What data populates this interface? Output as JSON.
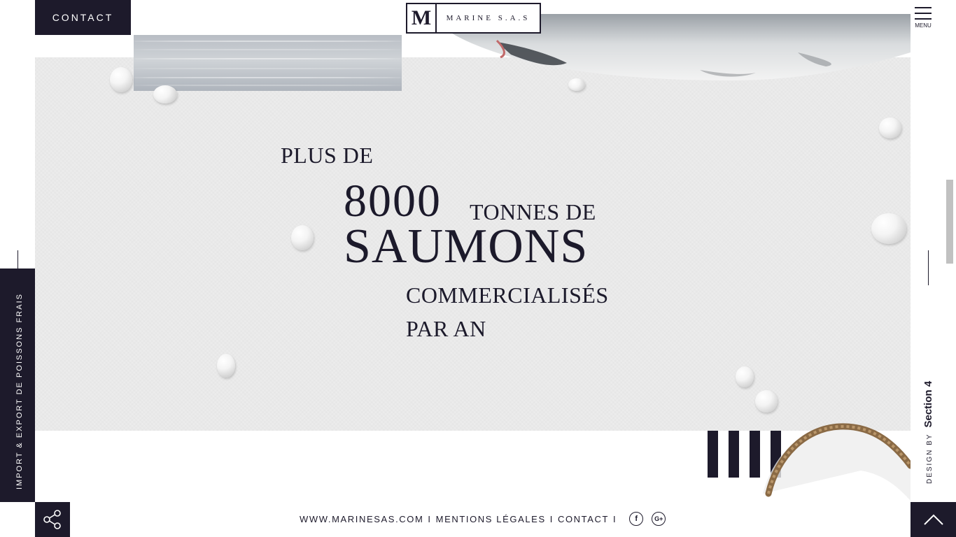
{
  "header": {
    "contact_label": "CONTACT",
    "logo_mark": "M",
    "logo_text": "MARINE S.A.S",
    "menu_label": "MENU"
  },
  "headline": {
    "line1": "PLUS DE",
    "number": "8000",
    "unit": "TONNES DE",
    "product": "SAUMONS",
    "line4": "COMMERCIALISÉS",
    "line5": "PAR AN"
  },
  "sidebar": {
    "tagline": "IMPORT & EXPORT DE POISSONS FRAIS"
  },
  "credit": {
    "design_by": "DESIGN BY",
    "studio": "Section 4"
  },
  "footer": {
    "site": "WWW.MARINESAS.COM",
    "separator": "I",
    "legal": "MENTIONS LÉGALES",
    "contact": "CONTACT",
    "facebook_glyph": "f",
    "google_glyph": "G+"
  },
  "icons": {
    "share": "share-icon",
    "up": "chevron-up-icon",
    "menu": "hamburger-icon",
    "facebook": "facebook-icon",
    "google": "google-plus-icon"
  },
  "colors": {
    "navy": "#1d1a2b",
    "panel": "#ececec"
  }
}
